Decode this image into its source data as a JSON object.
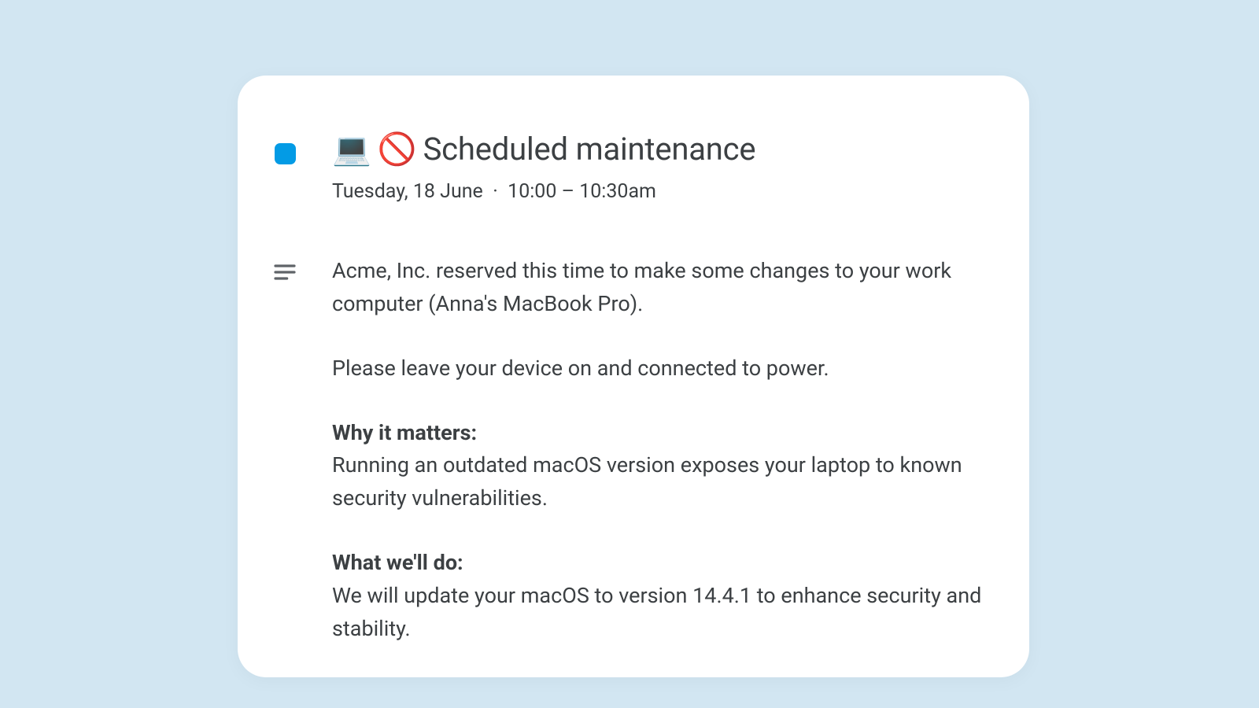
{
  "event": {
    "emoji_laptop": "💻",
    "emoji_prohibited": "🚫",
    "title": "Scheduled maintenance",
    "date": "Tuesday, 18 June",
    "separator": "·",
    "time": "10:00 – 10:30am"
  },
  "description": {
    "intro": "Acme, Inc. reserved this time to make some changes to your work computer (Anna's MacBook Pro).",
    "instruction": "Please leave your device on and connected to power.",
    "why_heading": "Why it matters:",
    "why_body": "Running an outdated macOS version exposes your laptop to known security vulnerabilities.",
    "what_heading": "What we'll do:",
    "what_body": "We will update your macOS to version 14.4.1 to enhance security and stability."
  },
  "colors": {
    "chip": "#039be5",
    "card_bg": "#ffffff",
    "page_bg": "#d2e6f2",
    "text": "#3c4043"
  }
}
